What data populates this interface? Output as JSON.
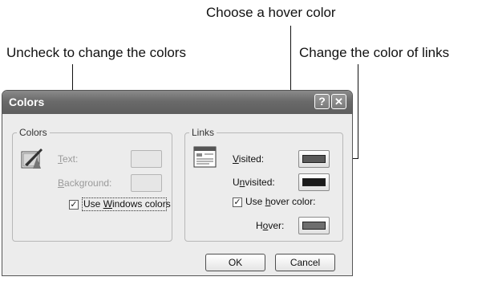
{
  "callouts": {
    "hover": "Choose a hover color",
    "uncheck": "Uncheck to change the colors",
    "links": "Change the color of links"
  },
  "dialog": {
    "title": "Colors",
    "help_button": "?",
    "close_button": "✕",
    "colors_group": {
      "legend": "Colors",
      "text_label_pre": "",
      "text_label_key": "T",
      "text_label_post": "ext:",
      "background_label_pre": "",
      "background_label_key": "B",
      "background_label_post": "ackground:",
      "use_windows_pre": "Use ",
      "use_windows_key": "W",
      "use_windows_post": "indows colors",
      "use_windows_checked": true,
      "icon": "brush-palette-icon"
    },
    "links_group": {
      "legend": "Links",
      "visited_pre": "",
      "visited_key": "V",
      "visited_post": "isited:",
      "unvisited_pre": "U",
      "unvisited_key": "n",
      "unvisited_post": "visited:",
      "use_hover_pre": "Use ",
      "use_hover_key": "h",
      "use_hover_post": "over color:",
      "use_hover_checked": true,
      "hover_pre": "H",
      "hover_key": "o",
      "hover_post": "ver:",
      "icon": "web-page-icon",
      "visited_color": "#5a5a5a",
      "unvisited_color": "#1a1a1a",
      "hover_color": "#6e6e6e"
    },
    "ok_label": "OK",
    "cancel_label": "Cancel"
  }
}
